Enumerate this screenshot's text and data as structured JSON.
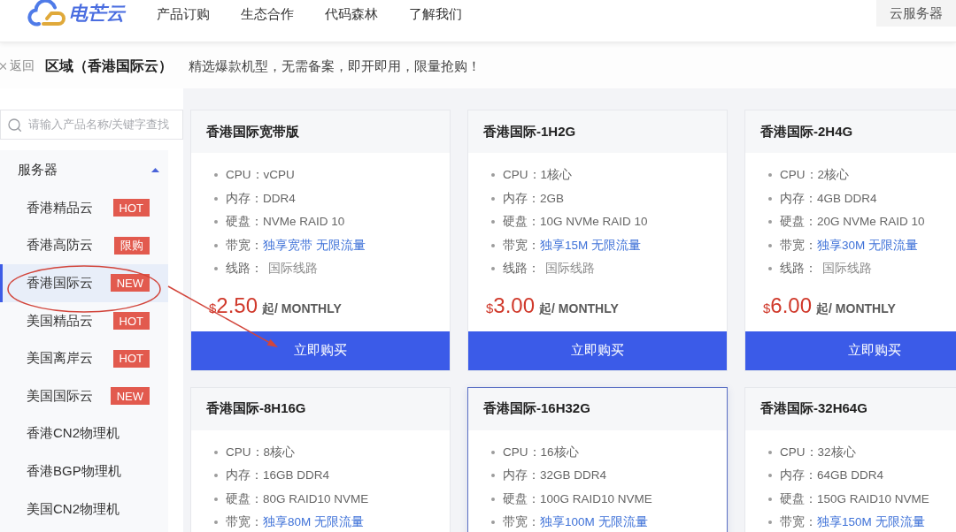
{
  "header": {
    "logo_text": "电芒云",
    "nav": [
      "产品订购",
      "生态合作",
      "代码森林",
      "了解我们"
    ],
    "corner_link": "云服务器"
  },
  "title_bar": {
    "back": "返回",
    "title": "区域（香港国际云）",
    "tagline": "精选爆款机型，无需备案，即开即用，限量抢购！"
  },
  "sidebar": {
    "search": {
      "placeholder": "请输入产品名称/关键字查找"
    },
    "group": {
      "label": "服务器",
      "expanded": true,
      "items": [
        {
          "label": "香港精品云",
          "badge": "HOT",
          "selected": false
        },
        {
          "label": "香港高防云",
          "badge": "限购",
          "selected": false
        },
        {
          "label": "香港国际云",
          "badge": "NEW",
          "selected": true
        },
        {
          "label": "美国精品云",
          "badge": "HOT",
          "selected": false
        },
        {
          "label": "美国离岸云",
          "badge": "HOT",
          "selected": false
        },
        {
          "label": "美国国际云",
          "badge": "NEW",
          "selected": false
        },
        {
          "label": "香港CN2物理机",
          "selected": false
        },
        {
          "label": "香港BGP物理机",
          "selected": false
        },
        {
          "label": "美国CN2物理机",
          "selected": false
        }
      ]
    }
  },
  "products": [
    {
      "name": "香港国际宽带版",
      "selected": false,
      "specs": [
        {
          "label": "CPU：",
          "value": "vCPU",
          "kind": "plain"
        },
        {
          "label": "内存：",
          "value": "DDR4",
          "kind": "plain"
        },
        {
          "label": "硬盘：",
          "value": "NVMe RAID 10",
          "kind": "plain"
        },
        {
          "label": "带宽：",
          "value": "独享宽带 无限流量",
          "kind": "accent"
        },
        {
          "label": "线路：",
          "value": "国际线路",
          "kind": "muted"
        }
      ],
      "price": {
        "currency": "$",
        "amount": "2.50",
        "unit": "起/ MONTHLY"
      },
      "buy_button": "立即购买"
    },
    {
      "name": "香港国际-1H2G",
      "selected": false,
      "specs": [
        {
          "label": "CPU：",
          "value": "1核心",
          "kind": "plain"
        },
        {
          "label": "内存：",
          "value": "2GB",
          "kind": "plain"
        },
        {
          "label": "硬盘：",
          "value": "10G NVMe RAID 10",
          "kind": "plain"
        },
        {
          "label": "带宽：",
          "value": "独享15M 无限流量",
          "kind": "accent"
        },
        {
          "label": "线路：",
          "value": "国际线路",
          "kind": "muted"
        }
      ],
      "price": {
        "currency": "$",
        "amount": "3.00",
        "unit": "起/ MONTHLY"
      },
      "buy_button": "立即购买"
    },
    {
      "name": "香港国际-2H4G",
      "selected": false,
      "specs": [
        {
          "label": "CPU：",
          "value": "2核心",
          "kind": "plain"
        },
        {
          "label": "内存：",
          "value": "4GB DDR4",
          "kind": "plain"
        },
        {
          "label": "硬盘：",
          "value": "20G NVMe RAID 10",
          "kind": "plain"
        },
        {
          "label": "带宽：",
          "value": "独享30M 无限流量",
          "kind": "accent"
        },
        {
          "label": "线路：",
          "value": "国际线路",
          "kind": "muted"
        }
      ],
      "price": {
        "currency": "$",
        "amount": "6.00",
        "unit": "起/ MONTHLY"
      },
      "buy_button": "立即购买"
    },
    {
      "name": "香港国际-8H16G",
      "selected": false,
      "specs": [
        {
          "label": "CPU：",
          "value": "8核心",
          "kind": "plain"
        },
        {
          "label": "内存：",
          "value": "16GB DDR4",
          "kind": "plain"
        },
        {
          "label": "硬盘：",
          "value": "80G RAID10 NVME",
          "kind": "plain"
        },
        {
          "label": "带宽：",
          "value": "独享80M 无限流量",
          "kind": "accent"
        }
      ]
    },
    {
      "name": "香港国际-16H32G",
      "selected": true,
      "specs": [
        {
          "label": "CPU：",
          "value": "16核心",
          "kind": "plain"
        },
        {
          "label": "内存：",
          "value": "32GB DDR4",
          "kind": "plain"
        },
        {
          "label": "硬盘：",
          "value": "100G RAID10 NVME",
          "kind": "plain"
        },
        {
          "label": "带宽：",
          "value": "独享100M 无限流量",
          "kind": "accent"
        }
      ]
    },
    {
      "name": "香港国际-32H64G",
      "selected": false,
      "specs": [
        {
          "label": "CPU：",
          "value": "32核心",
          "kind": "plain"
        },
        {
          "label": "内存：",
          "value": "64GB DDR4",
          "kind": "plain"
        },
        {
          "label": "硬盘：",
          "value": "150G RAID10 NVME",
          "kind": "plain"
        },
        {
          "label": "带宽：",
          "value": "独享150M 无限流量",
          "kind": "accent"
        }
      ]
    }
  ]
}
